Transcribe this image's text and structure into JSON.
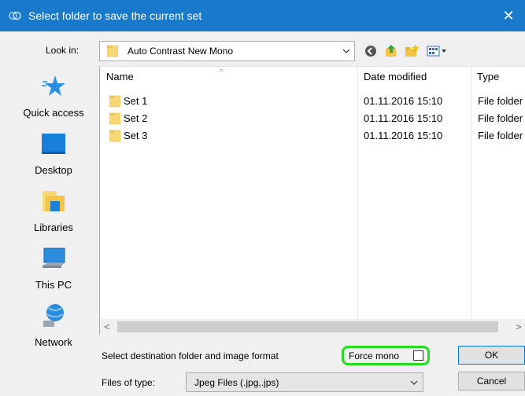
{
  "window": {
    "title": "Select folder to save the current set",
    "close_label": "✕"
  },
  "lookin": {
    "label": "Look in:",
    "value": "Auto Contrast New Mono"
  },
  "toolbar": {
    "icons": [
      "back-icon",
      "up-folder-icon",
      "new-folder-icon",
      "view-menu-icon"
    ]
  },
  "places": [
    {
      "label": "Quick access",
      "icon": "star-icon"
    },
    {
      "label": "Desktop",
      "icon": "desktop-icon"
    },
    {
      "label": "Libraries",
      "icon": "libraries-icon"
    },
    {
      "label": "This PC",
      "icon": "computer-icon"
    },
    {
      "label": "Network",
      "icon": "network-icon"
    }
  ],
  "filelist": {
    "columns": [
      "Name",
      "Date modified",
      "Type"
    ],
    "sort_indicator": "^",
    "rows": [
      {
        "name": "Set 1",
        "date": "01.11.2016 15:10",
        "type": "File folder"
      },
      {
        "name": "Set 2",
        "date": "01.11.2016 15:10",
        "type": "File folder"
      },
      {
        "name": "Set 3",
        "date": "01.11.2016 15:10",
        "type": "File folder"
      }
    ],
    "scroll_left": "<",
    "scroll_right": ">"
  },
  "bottom": {
    "destination_label": "Select destination folder and image format",
    "force_mono_label": "Force mono",
    "force_mono_checked": false,
    "files_of_type_label": "Files of type:",
    "files_of_type_value": "Jpeg Files (.jpg,.jps)",
    "ok_label": "OK",
    "cancel_label": "Cancel"
  },
  "colors": {
    "titlebar": "#1979ca",
    "highlight_border": "#22dd22",
    "folder": "#f8d775"
  }
}
